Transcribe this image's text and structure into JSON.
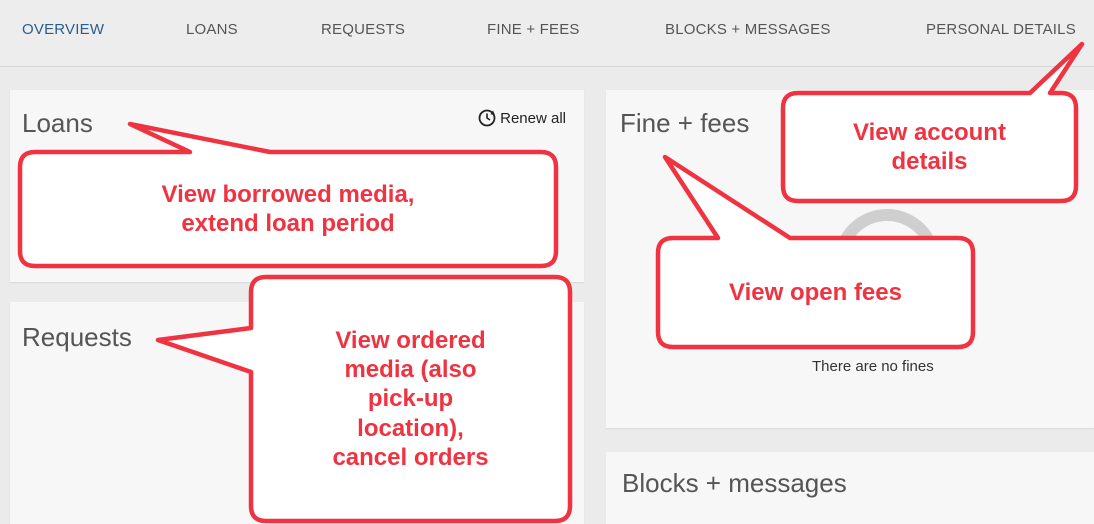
{
  "nav": {
    "tabs": [
      {
        "label": "OVERVIEW",
        "active": true
      },
      {
        "label": "LOANS",
        "active": false
      },
      {
        "label": "REQUESTS",
        "active": false
      },
      {
        "label": "FINE + FEES",
        "active": false
      },
      {
        "label": "BLOCKS + MESSAGES",
        "active": false
      },
      {
        "label": "PERSONAL DETAILS",
        "active": false
      }
    ]
  },
  "loans": {
    "title": "Loans",
    "renew_all_label": "Renew all",
    "renew_icon": "renew-clock-icon"
  },
  "requests": {
    "title": "Requests"
  },
  "fines": {
    "title": "Fine + fees",
    "empty_text": "There are no fines"
  },
  "blocks": {
    "title": "Blocks + messages"
  },
  "callouts": {
    "borrowed": "View borrowed media,\nextend loan period",
    "ordered": "View ordered\nmedia (also\npick-up\nlocation),\ncancel orders",
    "fees": "View open fees",
    "account": "View account\ndetails"
  },
  "colors": {
    "callout_border": "#ef3340",
    "active_tab": "#2d5d8a"
  }
}
